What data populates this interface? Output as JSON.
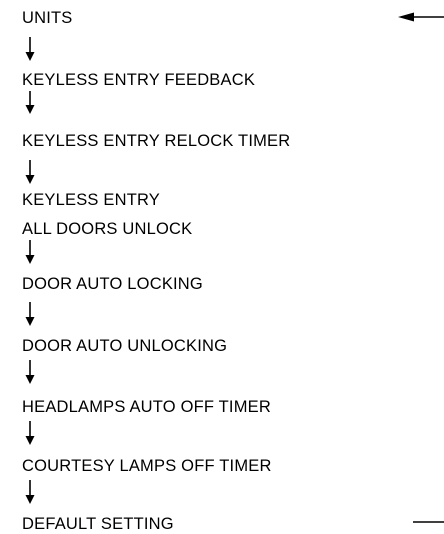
{
  "diagram": {
    "steps": [
      {
        "lines": [
          "UNITS"
        ]
      },
      {
        "lines": [
          "KEYLESS ENTRY FEEDBACK"
        ]
      },
      {
        "lines": [
          "KEYLESS ENTRY RELOCK TIMER"
        ]
      },
      {
        "lines": [
          "KEYLESS ENTRY",
          "ALL DOORS UNLOCK"
        ]
      },
      {
        "lines": [
          "DOOR AUTO LOCKING"
        ]
      },
      {
        "lines": [
          "DOOR AUTO UNLOCKING"
        ]
      },
      {
        "lines": [
          "HEADLAMPS AUTO OFF TIMER"
        ]
      },
      {
        "lines": [
          "COURTESY LAMPS OFF TIMER"
        ]
      },
      {
        "lines": [
          "DEFAULT SETTING"
        ]
      }
    ]
  }
}
